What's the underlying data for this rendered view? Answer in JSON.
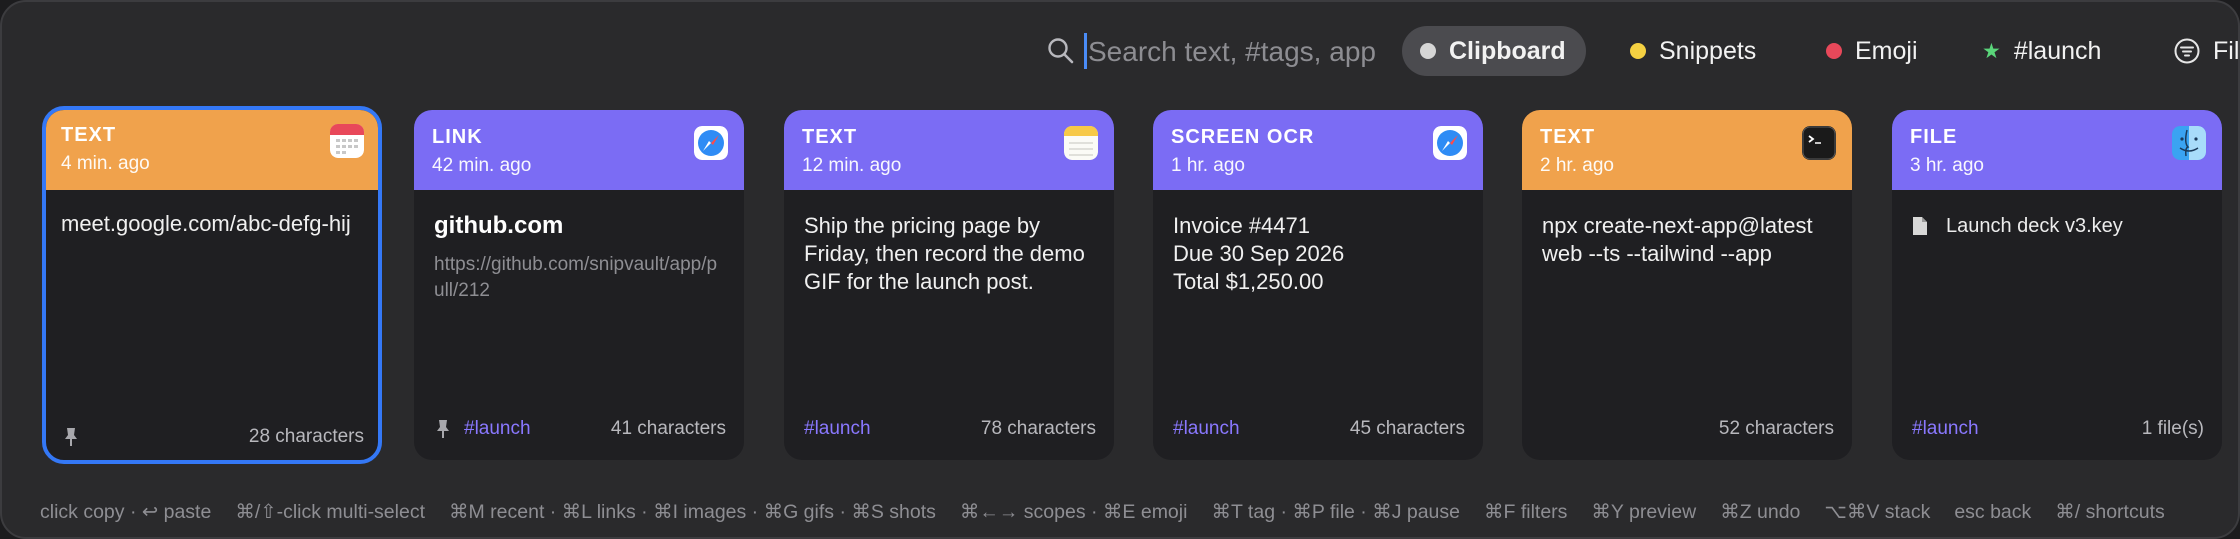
{
  "search": {
    "placeholder": "Search text, #tags, app"
  },
  "scopes": [
    {
      "label": "Clipboard",
      "color": "#d6d6d6",
      "active": true
    },
    {
      "label": "Snippets",
      "color": "#f5d142"
    },
    {
      "label": "Emoji",
      "color": "#e8485a"
    },
    {
      "label": "#launch",
      "icon": "star-icon",
      "color": "#5ad57a"
    },
    {
      "label": "Filt",
      "icon": "filter-icon"
    }
  ],
  "cards": [
    {
      "type": "TEXT",
      "time": "4 min. ago",
      "header_color": "#f0a24c",
      "app_icon": "calendar-icon",
      "content": "meet.google.com/abc-defg-hij",
      "pinned": true,
      "tag": "",
      "count": "28 characters",
      "selected": true
    },
    {
      "type": "LINK",
      "time": "42 min. ago",
      "header_color": "#7b6cf4",
      "app_icon": "safari-icon",
      "title": "github.com",
      "url": "https://github.com/snipvault/app/pull/212",
      "pinned": true,
      "tag": "#launch",
      "count": "41 characters"
    },
    {
      "type": "TEXT",
      "time": "12 min. ago",
      "header_color": "#7b6cf4",
      "app_icon": "notes-icon",
      "content": "Ship the pricing page by Friday, then record the demo GIF for the launch post.",
      "tag": "#launch",
      "count": "78 characters"
    },
    {
      "type": "SCREEN OCR",
      "time": "1 hr. ago",
      "header_color": "#7b6cf4",
      "app_icon": "safari-icon",
      "lines": [
        "Invoice #4471",
        "Due 30 Sep 2026",
        "Total $1,250.00"
      ],
      "tag": "#launch",
      "count": "45 characters"
    },
    {
      "type": "TEXT",
      "time": "2 hr. ago",
      "header_color": "#f0a24c",
      "app_icon": "terminal-icon",
      "content": "npx create-next-app@latest web --ts --tailwind --app",
      "tag": "",
      "count": "52 characters"
    },
    {
      "type": "FILE",
      "time": "3 hr. ago",
      "header_color": "#7b6cf4",
      "app_icon": "finder-icon",
      "file_name": "Launch deck v3.key",
      "tag": "#launch",
      "count": "1 file(s)"
    }
  ],
  "shortcuts": [
    "click copy · ↩ paste",
    "⌘/⇧-click multi-select",
    "⌘M recent · ⌘L links · ⌘I images · ⌘G gifs · ⌘S shots",
    "⌘←→ scopes · ⌘E emoji",
    "⌘T tag · ⌘P file · ⌘J pause",
    "⌘F filters",
    "⌘Y preview",
    "⌘Z undo",
    "⌥⌘V stack",
    "esc back",
    "⌘/ shortcuts"
  ]
}
